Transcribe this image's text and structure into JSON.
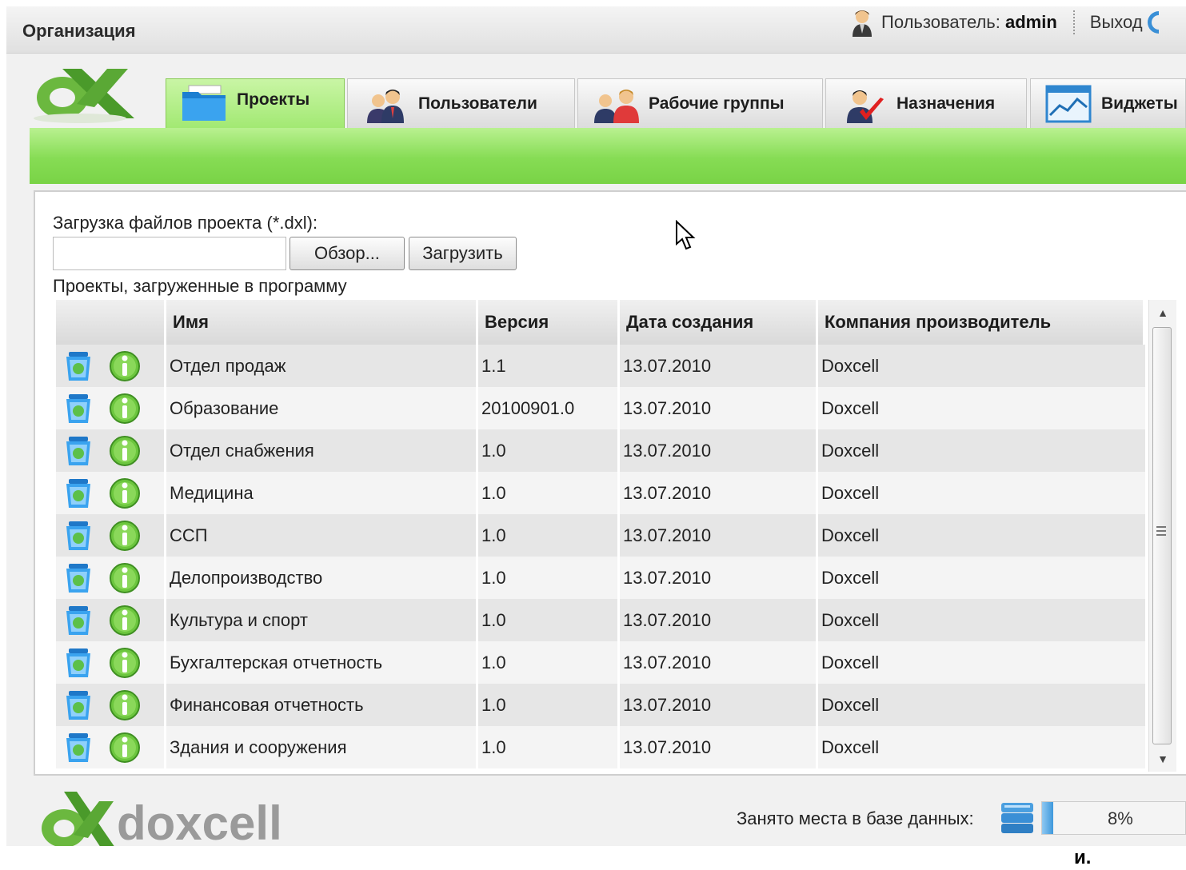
{
  "app": {
    "org_title": "Организация",
    "user_label": "Пользователь: ",
    "user_name": "admin",
    "logout_label": "Выход"
  },
  "tabs": [
    {
      "label": "Проекты",
      "icon": "folder-icon",
      "active": true
    },
    {
      "label": "Пользователи",
      "icon": "users-icon",
      "active": false
    },
    {
      "label": "Рабочие группы",
      "icon": "workgroups-icon",
      "active": false
    },
    {
      "label": "Назначения",
      "icon": "assignment-icon",
      "active": false
    },
    {
      "label": "Виджеты",
      "icon": "widget-chart-icon",
      "active": false
    }
  ],
  "upload": {
    "label": "Загрузка файлов проекта (*.dxl):",
    "file_value": "",
    "browse_label": "Обзор...",
    "upload_label": "Загрузить"
  },
  "projects": {
    "caption": "Проекты, загруженные в программу",
    "columns": [
      "",
      "Имя",
      "Версия",
      "Дата создания",
      "Компания производитель"
    ],
    "rows": [
      {
        "name": "Отдел продаж",
        "version": "1.1",
        "date": "13.07.2010",
        "company": "Doxcell"
      },
      {
        "name": "Образование",
        "version": "20100901.0",
        "date": "13.07.2010",
        "company": "Doxcell"
      },
      {
        "name": "Отдел снабжения",
        "version": "1.0",
        "date": "13.07.2010",
        "company": "Doxcell"
      },
      {
        "name": "Медицина",
        "version": "1.0",
        "date": "13.07.2010",
        "company": "Doxcell"
      },
      {
        "name": "ССП",
        "version": "1.0",
        "date": "13.07.2010",
        "company": "Doxcell"
      },
      {
        "name": "Делопроизводство",
        "version": "1.0",
        "date": "13.07.2010",
        "company": "Doxcell"
      },
      {
        "name": "Культура и спорт",
        "version": "1.0",
        "date": "13.07.2010",
        "company": "Doxcell"
      },
      {
        "name": "Бухгалтерская отчетность",
        "version": "1.0",
        "date": "13.07.2010",
        "company": "Doxcell"
      },
      {
        "name": "Финансовая отчетность",
        "version": "1.0",
        "date": "13.07.2010",
        "company": "Doxcell"
      },
      {
        "name": "Здания и сооружения",
        "version": "1.0",
        "date": "13.07.2010",
        "company": "Doxcell"
      }
    ],
    "row_icons": [
      "recycle-bin-icon",
      "info-icon"
    ]
  },
  "footer": {
    "logo_text": "doxcell",
    "storage_label": "Занято места в базе данных:",
    "storage_percent_text": "8%",
    "storage_fraction": 0.08,
    "overlay_text": "и."
  },
  "colors": {
    "tab_green": "#8fe35a",
    "bar_green": "#86dc54",
    "logo_green": "#4a9a2a",
    "progress_blue": "#3d98dc"
  }
}
